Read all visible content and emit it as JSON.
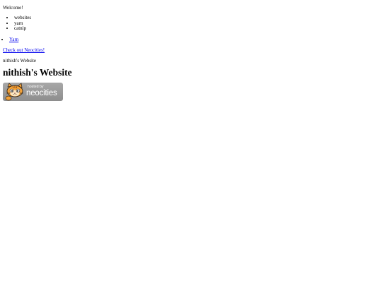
{
  "welcome_text": "Welcome!",
  "interests": [
    "websites",
    "yarn",
    "catnip"
  ],
  "links": [
    {
      "label": "Yarn"
    }
  ],
  "neocities_link": "Check out Neocities!",
  "small_title": "nithish's Website",
  "heading": "nithish's Website",
  "badge": {
    "hosted_text": "hosted by",
    "brand_text": "neocities",
    "background": "#999999",
    "cat_orange": "#f2a23a"
  }
}
